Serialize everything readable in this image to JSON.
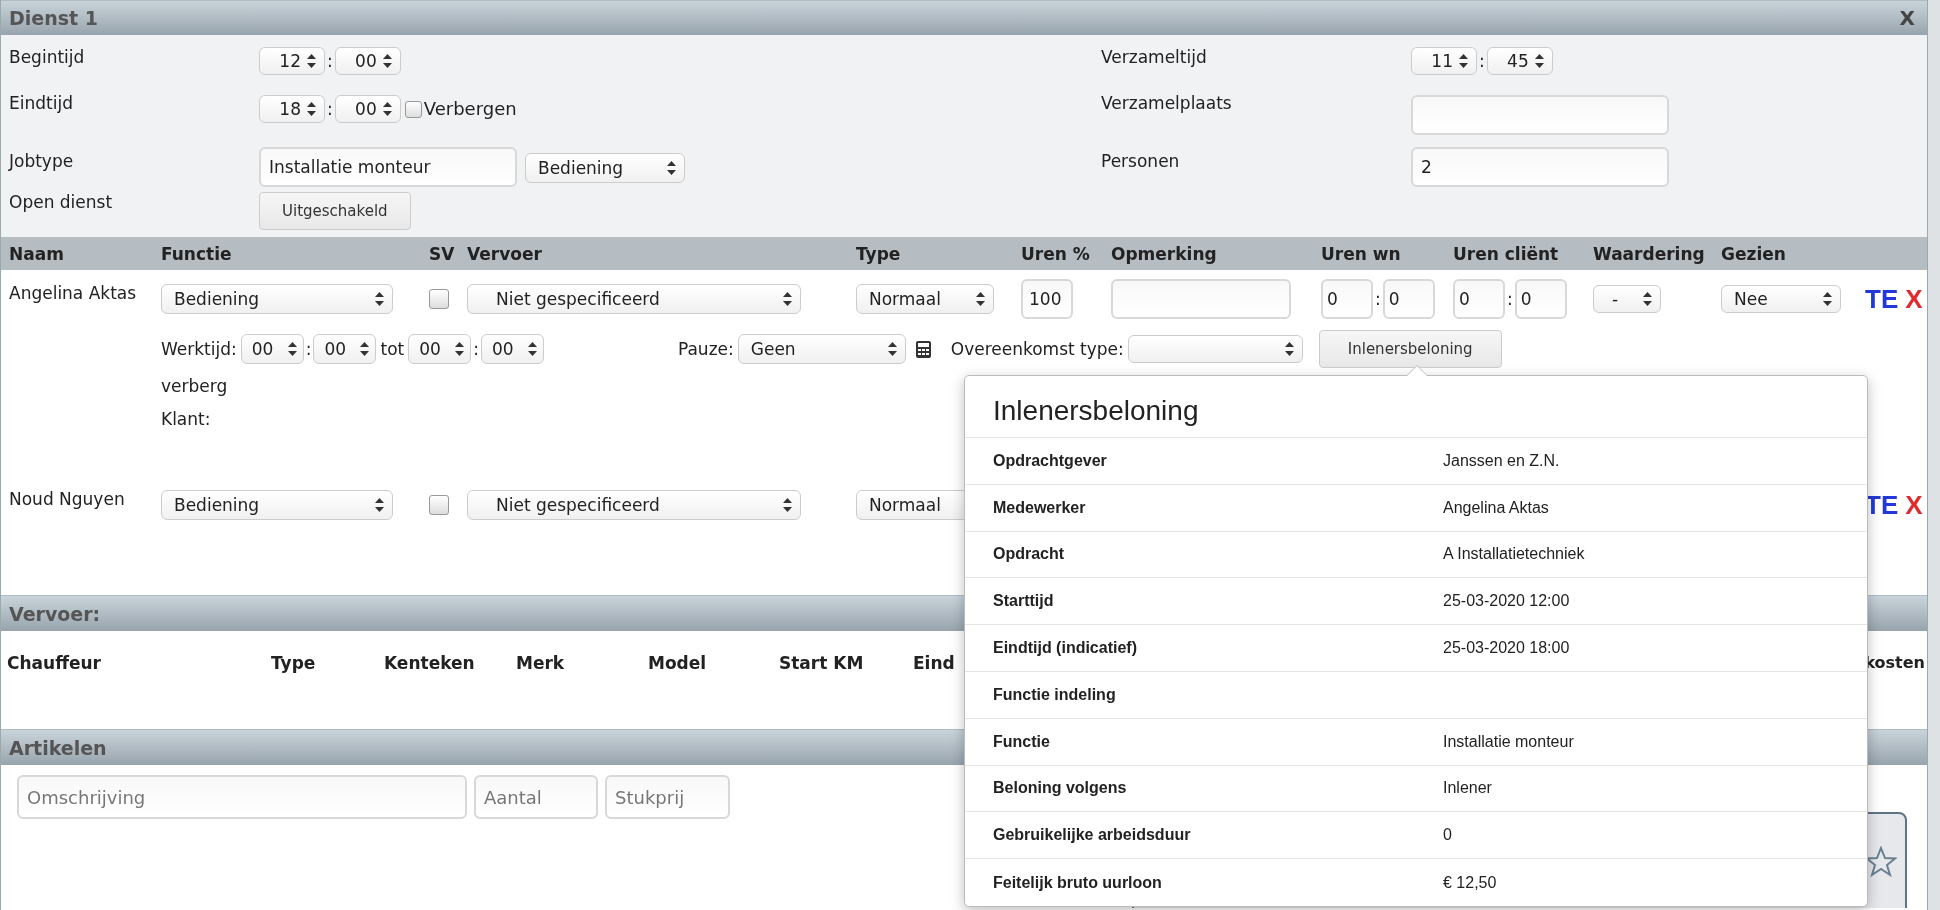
{
  "dialog": {
    "title": "Dienst 1",
    "close": "X"
  },
  "form_left": [
    {
      "label": "Begintijd",
      "kind": "time",
      "time": {
        "hour": "12",
        "separator": ":",
        "minute": "00"
      }
    },
    {
      "label": "Eindtijd",
      "kind": "time",
      "time": {
        "hour": "18",
        "separator": ":",
        "minute": "00"
      },
      "checkbox": {
        "label": "Verbergen",
        "checked": false
      }
    },
    {
      "label": "Jobtype",
      "kind": "text_select",
      "value": "Installatie monteur",
      "select": "Bediening"
    },
    {
      "label": "Open dienst",
      "kind": "button",
      "button": "Uitgeschakeld"
    }
  ],
  "form_right": [
    {
      "label": "Verzameltijd",
      "kind": "time",
      "time": {
        "hour": "11",
        "separator": ":",
        "minute": "45"
      }
    },
    {
      "label": "Verzamelplaats",
      "kind": "text"
    },
    {
      "label": "Personen",
      "kind": "text",
      "value": "2"
    }
  ],
  "staff_table": {
    "columns": [
      "Naam",
      "Functie",
      "SV",
      "Vervoer",
      "Type",
      "Uren %",
      "Opmerking",
      "Uren wn",
      "Uren cliënt",
      "Waardering",
      "Gezien"
    ],
    "rows": [
      {
        "name": "Angelina Aktas",
        "functie": "Bediening",
        "sv_checked": false,
        "vervoer": "Niet gespecificeerd",
        "type": "Normaal",
        "uren_pct": "100",
        "opmerking_field": true,
        "uren_wn": {
          "hours": "0",
          "separator": ":",
          "minutes": "0"
        },
        "uren_client": {
          "hours": "0",
          "separator": ":",
          "minutes": "0"
        },
        "waardering": "-",
        "gezien": "Nee",
        "edit": "TE",
        "delete": "X",
        "details": {
          "werktijd_label": "Werktijd:",
          "start": {
            "hour": "00",
            "separator": ":",
            "minute": "00"
          },
          "to_label": "tot",
          "end": {
            "hour": "00",
            "separator": ":",
            "minute": "00"
          },
          "pauze_label": "Pauze:",
          "pauze": "Geen",
          "agreement_label": "Overeenkomst type:",
          "agreement_button": "Inlenersbeloning",
          "hide_label": "verberg",
          "client_label": "Klant:"
        }
      },
      {
        "name": "Noud Nguyen",
        "functie": "Bediening",
        "sv_checked": false,
        "vervoer": "Niet gespecificeerd",
        "type": "Normaal",
        "edit": "TE",
        "delete": "X"
      }
    ]
  },
  "popover": {
    "title": "Inlenersbeloning",
    "rows": [
      {
        "label": "Opdrachtgever",
        "value": "Janssen en Z.N."
      },
      {
        "label": "Medewerker",
        "value": "Angelina Aktas"
      },
      {
        "label": "Opdracht",
        "value": "A Installatietechniek"
      },
      {
        "label": "Starttijd",
        "value": "25-03-2020 12:00"
      },
      {
        "label": "Eindtijd (indicatief)",
        "value": "25-03-2020 18:00"
      },
      {
        "label": "Functie indeling"
      },
      {
        "label": "Functie",
        "value": "Installatie monteur"
      },
      {
        "label": "Beloning volgens",
        "value": "Inlener"
      },
      {
        "label": "Gebruikelijke arbeidsduur",
        "value": "0"
      },
      {
        "label": "Feitelijk bruto uurloon",
        "value": "€ 12,50"
      }
    ]
  },
  "vervoer": {
    "title": "Vervoer:",
    "columns": [
      "Chauffeur",
      "Type",
      "Kenteken",
      "Merk",
      "Model",
      "Start KM",
      "Eind",
      "kosten"
    ]
  },
  "artikelen": {
    "title": "Artikelen",
    "fields": [
      {
        "placeholder": "Omschrijving"
      },
      {
        "placeholder": "Aantal"
      },
      {
        "placeholder": "Stukprij"
      }
    ]
  }
}
